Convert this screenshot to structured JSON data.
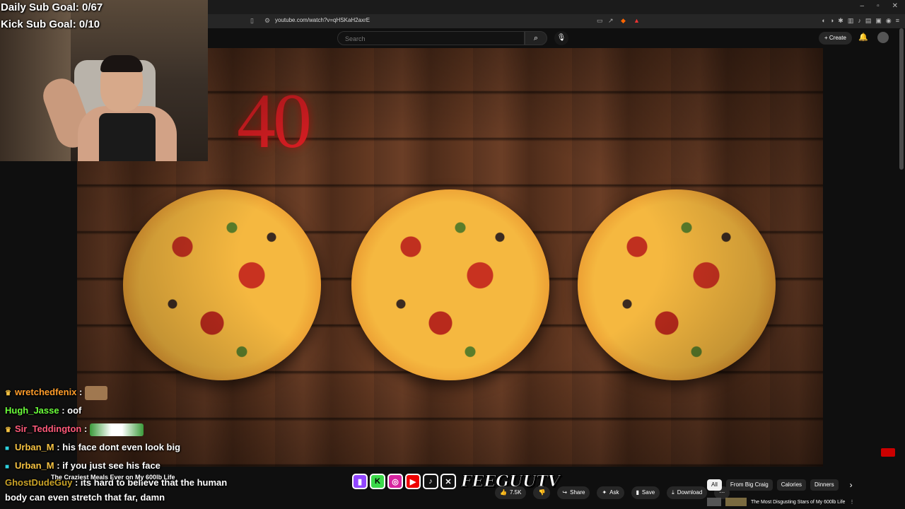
{
  "overlay": {
    "daily_sub_goal": "Daily Sub Goal: 0/67",
    "kick_sub_goal": "Kick Sub Goal: 0/10",
    "brand_name": "FEEGUUTV"
  },
  "browser": {
    "url": "youtube.com/watch?v=qHSKaH2axrE"
  },
  "youtube": {
    "search_placeholder": "Search",
    "create_label": "Create",
    "video_overlay_title": "The Craziest Meals Ever on My 600lb Life",
    "countdown_text": "40",
    "actions": {
      "likes": "7.5K",
      "share": "Share",
      "ask": "Ask",
      "save": "Save",
      "download": "Download"
    },
    "chips": [
      "All",
      "From Big Craig",
      "Calories",
      "Dinners"
    ],
    "related_title": "The Most Disgusting Stars of My 600lb Life"
  },
  "chat": [
    {
      "user": "wretchedfenix",
      "color": "#ff9c2a",
      "badge": "trophy",
      "text": ""
    },
    {
      "user": "Hugh_Jasse",
      "color": "#6bff3a",
      "badge": "",
      "text": "oof"
    },
    {
      "user": "Sir_Teddington",
      "color": "#ff5a7a",
      "badge": "trophy",
      "text": ""
    },
    {
      "user": "Urban_M",
      "color": "#f5c242",
      "badge": "sub",
      "text": "his face dont even look big"
    },
    {
      "user": "Urban_M",
      "color": "#f5c242",
      "badge": "sub",
      "text": "if you just see his face"
    },
    {
      "user": "GhostDudeGuy",
      "color": "#c9a227",
      "badge": "",
      "text": "its hard to believe that the human body can even stretch that far, damn"
    }
  ],
  "colors": {
    "youtube_bg": "#0f0f0f",
    "countdown_red": "#e21f24"
  }
}
